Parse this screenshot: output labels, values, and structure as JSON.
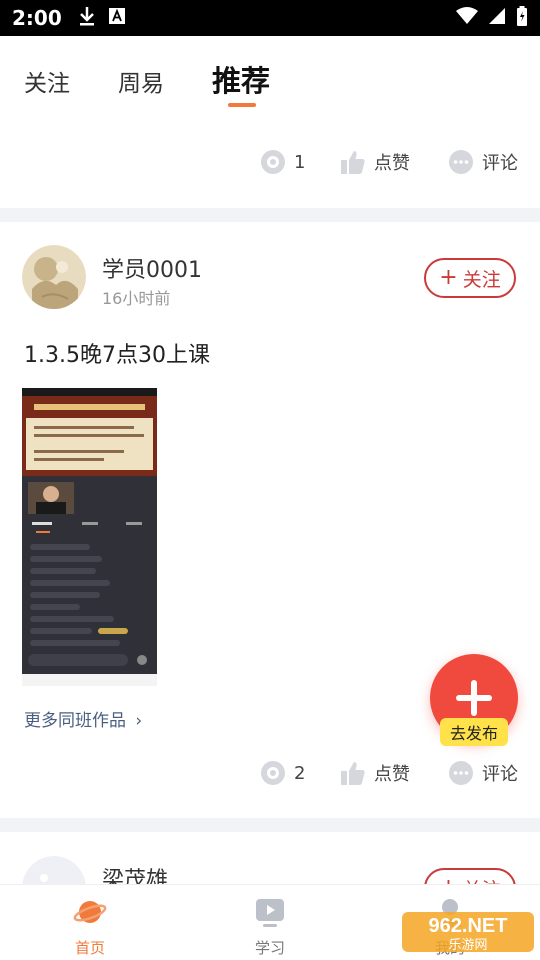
{
  "status_bar": {
    "time": "2:00",
    "icons": [
      "download-icon",
      "keyboard-a-icon",
      "wifi-icon",
      "signal-icon",
      "battery-icon"
    ]
  },
  "tabs": [
    {
      "label": "关注",
      "active": false
    },
    {
      "label": "周易",
      "active": false
    },
    {
      "label": "推荐",
      "active": true
    }
  ],
  "post_prev": {
    "views": "1",
    "like_label": "点赞",
    "comment_label": "评论"
  },
  "post": {
    "username": "学员0001",
    "time": "16小时前",
    "follow_label": "关注",
    "text": "1.3.5晚7点30上课",
    "more_link": "更多同班作品",
    "views": "2",
    "like_label": "点赞",
    "comment_label": "评论"
  },
  "post_next": {
    "username": "梁茂雄",
    "follow_label": "关注"
  },
  "fab": {
    "label": "去发布"
  },
  "bottom_nav": [
    {
      "label": "首页",
      "icon": "planet-icon",
      "active": true
    },
    {
      "label": "学习",
      "icon": "play-icon",
      "active": false
    },
    {
      "label": "我的",
      "icon": "profile-icon",
      "active": false
    }
  ],
  "watermark": {
    "text": "962.NET",
    "subtext": "乐游网"
  },
  "colors": {
    "accent": "#f07a3c",
    "follow": "#c93a3a",
    "fab": "#f04a3e",
    "fab_label_bg": "#ffe24a",
    "link": "#4a5f80"
  }
}
